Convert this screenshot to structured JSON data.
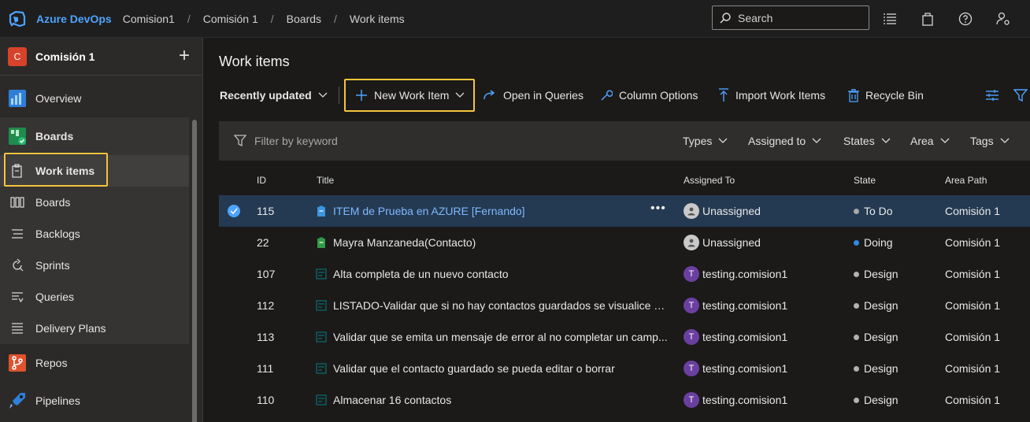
{
  "topbar": {
    "brand": "Azure DevOps",
    "breadcrumbs": [
      "Comision1",
      "Comisión 1",
      "Boards",
      "Work items"
    ],
    "separator": "/",
    "search_placeholder": "Search",
    "icons": [
      "list-settings-icon",
      "marketplace-bag-icon",
      "help-icon",
      "user-settings-icon"
    ]
  },
  "sidebar": {
    "project_initial": "C",
    "project_name": "Comisión 1",
    "add_symbol": "+",
    "items": {
      "overview": "Overview",
      "boards": "Boards",
      "work_items": "Work items",
      "boards_sub": "Boards",
      "backlogs": "Backlogs",
      "sprints": "Sprints",
      "queries": "Queries",
      "delivery_plans": "Delivery Plans",
      "repos": "Repos",
      "pipelines": "Pipelines"
    }
  },
  "main": {
    "title": "Work items",
    "toolbar": {
      "view": "Recently updated",
      "new_item": "New Work Item",
      "open_queries": "Open in Queries",
      "column_options": "Column Options",
      "import": "Import Work Items",
      "recycle": "Recycle Bin"
    },
    "filter": {
      "placeholder": "Filter by keyword",
      "types": "Types",
      "assigned": "Assigned to",
      "states": "States",
      "area": "Area",
      "tags": "Tags"
    },
    "columns": {
      "id": "ID",
      "title": "Title",
      "assigned": "Assigned To",
      "state": "State",
      "area": "Area Path"
    },
    "rows": [
      {
        "id": "115",
        "type": "task",
        "title": "ITEM de Prueba en AZURE [Fernando]",
        "assigned": "Unassigned",
        "avatar": "",
        "state": "To Do",
        "area": "Comisión 1"
      },
      {
        "id": "22",
        "type": "task",
        "title": "Mayra Manzaneda(Contacto)",
        "assigned": "Unassigned",
        "avatar": "",
        "state": "Doing",
        "area": "Comisión 1"
      },
      {
        "id": "107",
        "type": "testcase",
        "title": "Alta completa de un nuevo contacto",
        "assigned": "testing.comision1",
        "avatar": "T",
        "state": "Design",
        "area": "Comisión 1"
      },
      {
        "id": "112",
        "type": "testcase",
        "title": "LISTADO-Validar que si no hay contactos guardados se visualice el ...",
        "assigned": "testing.comision1",
        "avatar": "T",
        "state": "Design",
        "area": "Comisión 1"
      },
      {
        "id": "113",
        "type": "testcase",
        "title": "Validar que se emita un mensaje de error al no completar un camp...",
        "assigned": "testing.comision1",
        "avatar": "T",
        "state": "Design",
        "area": "Comisión 1"
      },
      {
        "id": "111",
        "type": "testcase",
        "title": "Validar que el contacto guardado se pueda editar o borrar",
        "assigned": "testing.comision1",
        "avatar": "T",
        "state": "Design",
        "area": "Comisión 1"
      },
      {
        "id": "110",
        "type": "testcase",
        "title": "Almacenar 16 contactos",
        "assigned": "testing.comision1",
        "avatar": "T",
        "state": "Design",
        "area": "Comisión 1"
      }
    ]
  },
  "colors": {
    "accent": "#4da3ff",
    "highlight": "#f4c43c",
    "state_todo": "#a8a8a8",
    "state_doing": "#2f89e6",
    "state_design": "#b2b2b2",
    "avatar": "#6b3fa0",
    "task_icon": "#3a96dd",
    "task_icon_green": "#339947",
    "testcase_icon": "#004b50"
  }
}
